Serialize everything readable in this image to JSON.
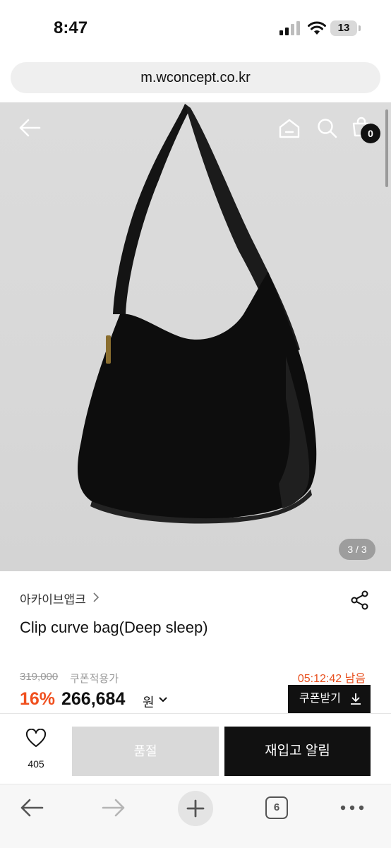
{
  "status_bar": {
    "time": "8:47",
    "battery": "13"
  },
  "browser": {
    "url": "m.wconcept.co.kr",
    "tab_count": "6"
  },
  "header": {
    "cart_count": "0"
  },
  "gallery": {
    "counter": "3 / 3"
  },
  "product": {
    "brand": "아카이브앱크",
    "title": "Clip curve bag(Deep sleep)",
    "original_price": "319,000",
    "coupon_label": "쿠폰적용가",
    "timer": "05:12:42 남음",
    "discount": "16%",
    "price": "266,684",
    "currency": "원",
    "coupon_button": "쿠폰받기"
  },
  "actions": {
    "likes": "405",
    "soldout_label": "품절",
    "restock_label": "재입고 알림"
  },
  "colors": {
    "accent": "#f0501f",
    "dark": "#111111",
    "soldout": "#d9d9d9"
  }
}
